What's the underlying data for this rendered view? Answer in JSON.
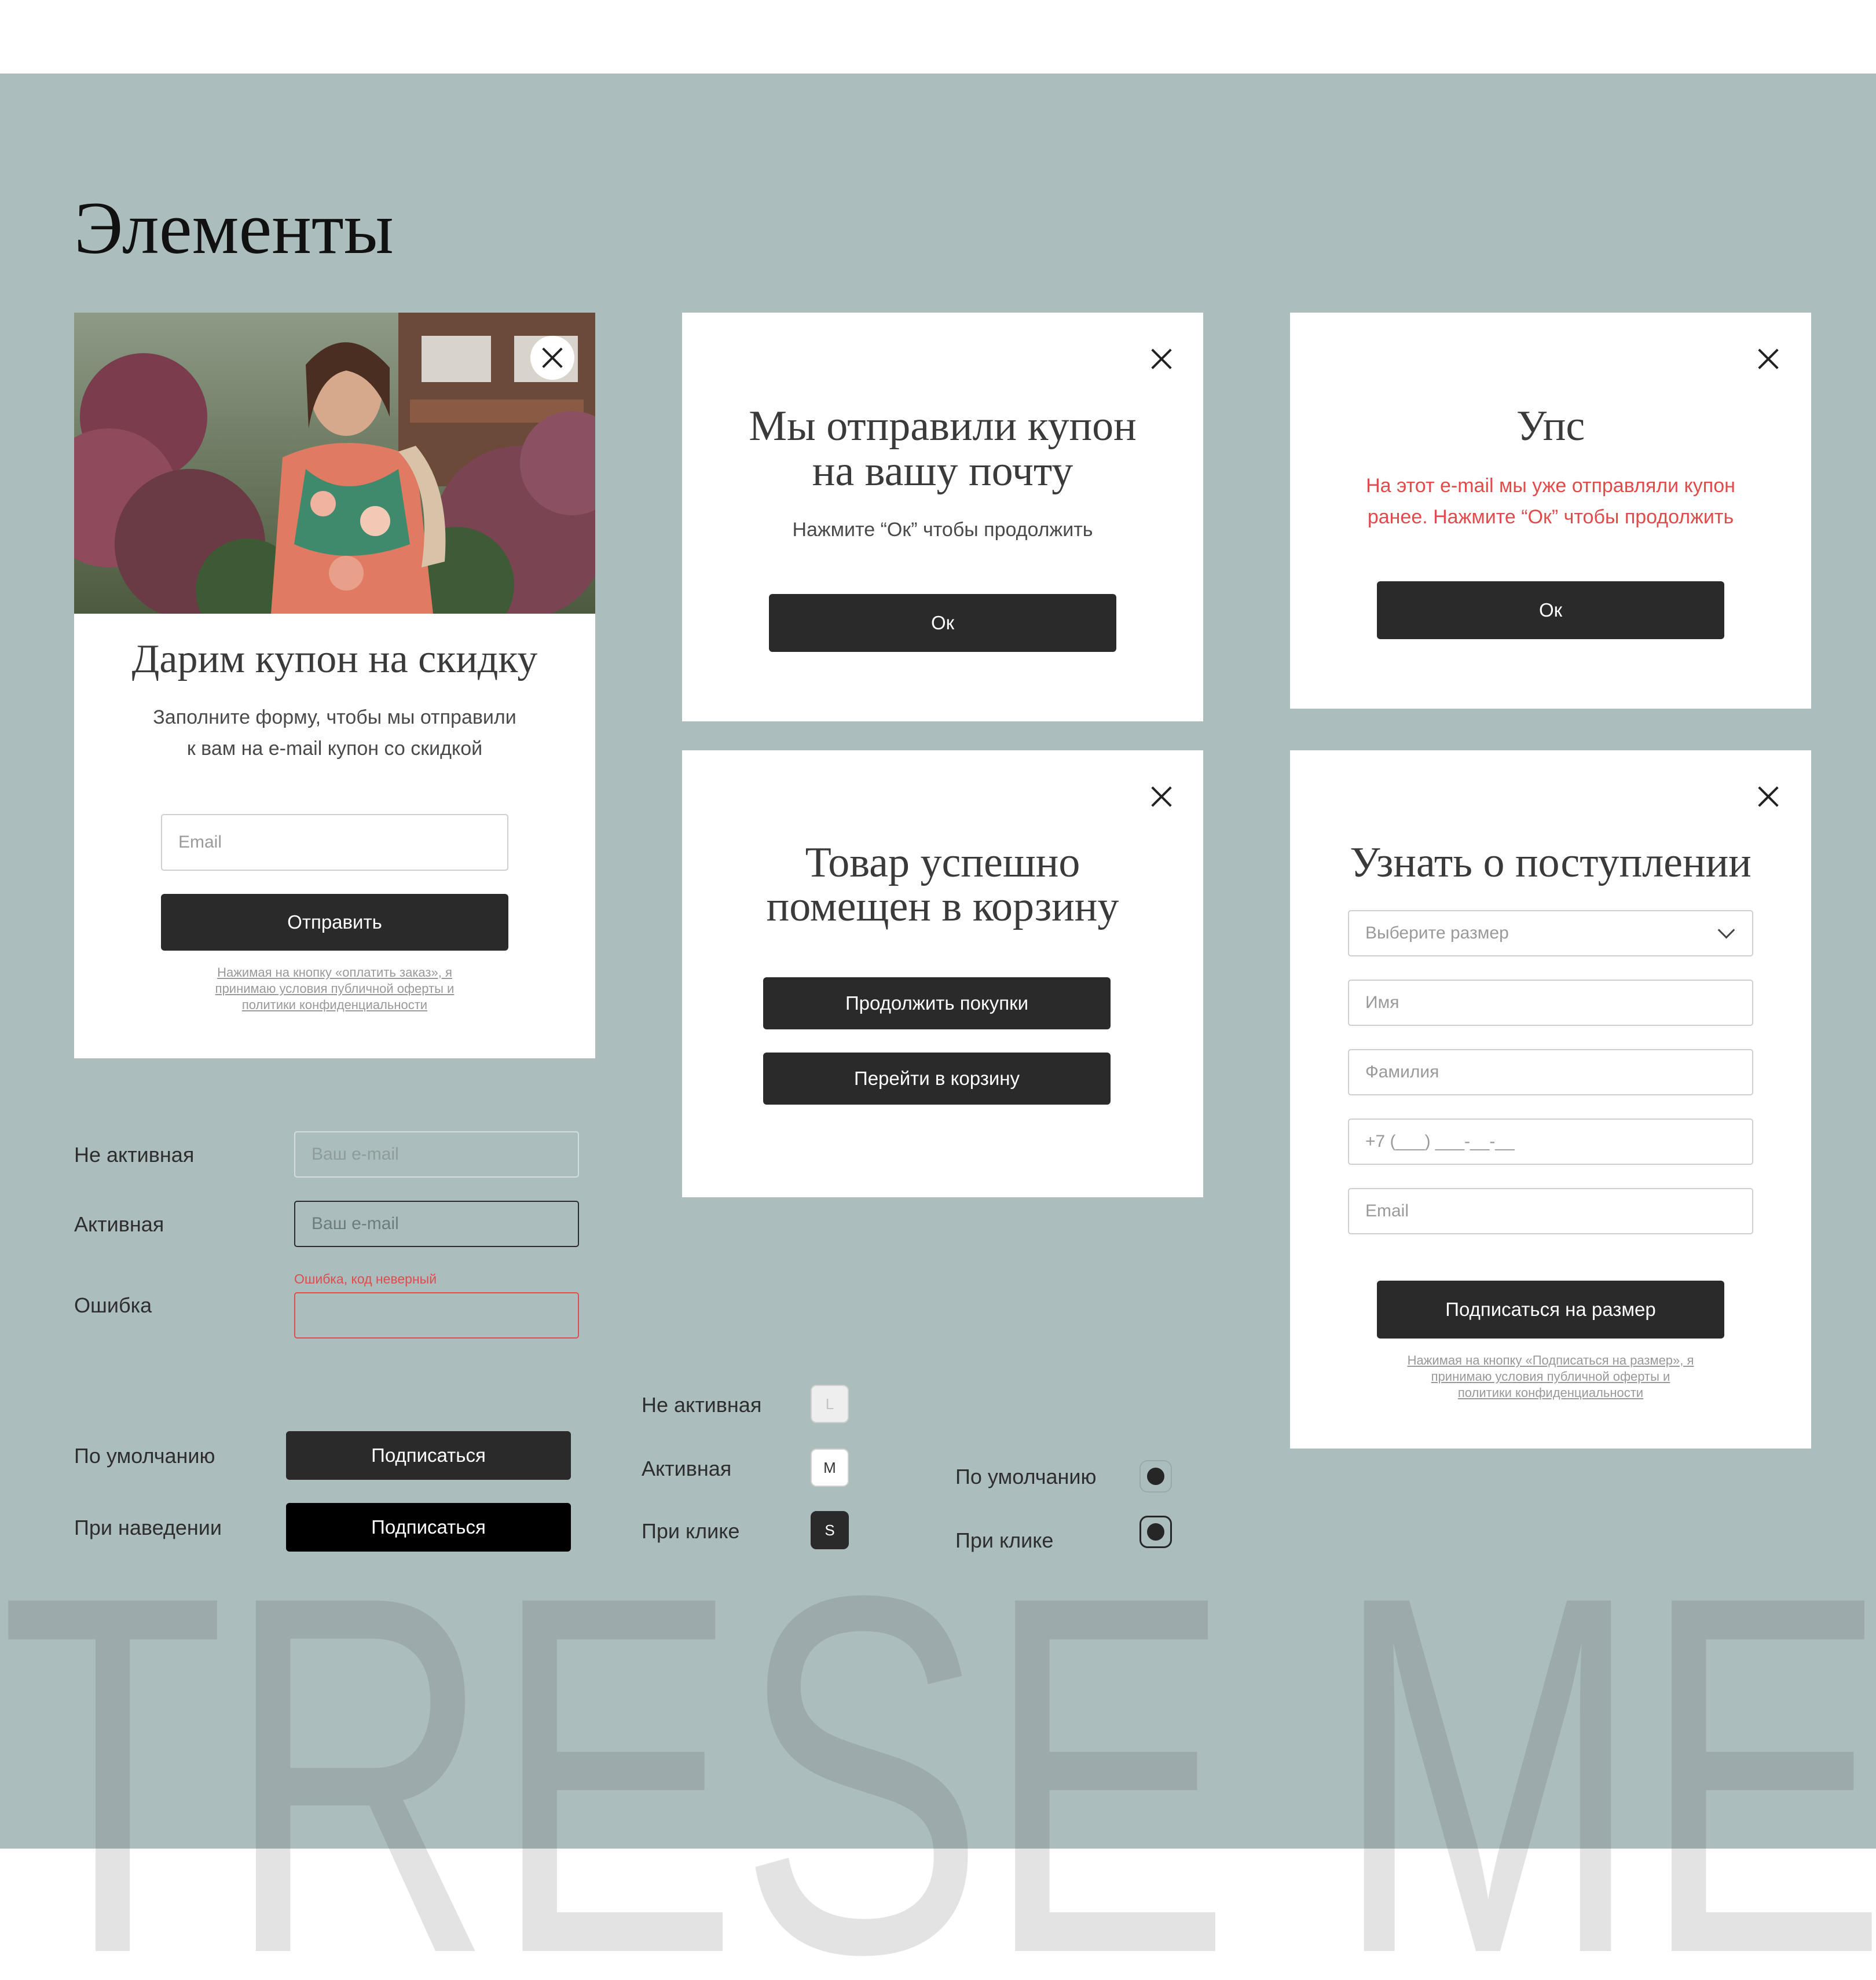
{
  "page": {
    "title": "Элементы",
    "watermark": "TRESE ME"
  },
  "colors": {
    "background": "#acbdbe",
    "dark_button": "#2a2a2a",
    "hover_button": "#000000",
    "error": "#e14b4b"
  },
  "coupon_popup": {
    "title": "Дарим купон на скидку",
    "subtitle_line1": "Заполните форму, чтобы мы отправили",
    "subtitle_line2": "к вам на e-mail купон со скидкой",
    "email_placeholder": "Email",
    "submit_label": "Отправить",
    "legal_line1": "Нажимая на кнопку «оплатить заказ», я",
    "legal_line2": "принимаю условия публичной оферты и",
    "legal_line3": "политики конфиденциальности"
  },
  "sent_popup": {
    "title_line1": "Мы отправили купон",
    "title_line2": "на вашу почту",
    "subtitle": "Нажмите “Ок” чтобы продолжить",
    "ok_label": "Ок"
  },
  "oops_popup": {
    "title": "Упс",
    "message_line1": "На этот e-mail мы уже отправляли купон",
    "message_line2": "ранее. Нажмите “Ок” чтобы продолжить",
    "ok_label": "Ок"
  },
  "cart_popup": {
    "title_line1": "Товар успешно",
    "title_line2": "помещен в корзину",
    "continue_label": "Продолжить покупки",
    "go_cart_label": "Перейти в корзину"
  },
  "notify_popup": {
    "title": "Узнать о поступлении",
    "size_placeholder": "Выберите размер",
    "name_placeholder": "Имя",
    "surname_placeholder": "Фамилия",
    "phone_placeholder": "+7 (___) ___-__-__",
    "email_placeholder": "Email",
    "submit_label": "Подписаться на размер",
    "legal_line1": "Нажимая на кнопку «Подписаться на размер», я",
    "legal_line2": "принимаю условия публичной оферты и",
    "legal_line3": "политики конфиденциальности"
  },
  "input_states": {
    "inactive_label": "Не активная",
    "active_label": "Активная",
    "error_label": "Ошибка",
    "placeholder": "Ваш e-mail",
    "error_message": "Ошибка, код неверный"
  },
  "button_states": {
    "default_label": "По умолчанию",
    "hover_label": "При наведении",
    "button_text": "Подписаться"
  },
  "size_states": {
    "inactive_label": "Не активная",
    "active_label": "Активная",
    "click_label": "При клике",
    "chip_inactive": "L",
    "chip_active": "M",
    "chip_click": "S"
  },
  "radio_states": {
    "default_label": "По умолчанию",
    "click_label": "При клике"
  }
}
